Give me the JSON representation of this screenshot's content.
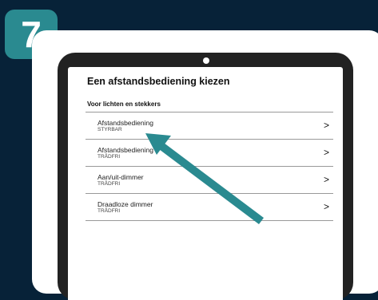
{
  "step": {
    "number": "7"
  },
  "screen": {
    "title": "Een afstandsbediening kiezen",
    "section_label": "Voor lichten en stekkers",
    "items": [
      {
        "name": "Afstandsbediening",
        "sub": "STYRBAR",
        "chevron": ">"
      },
      {
        "name": "Afstandsbediening",
        "sub": "TRÅDFRI",
        "chevron": ">"
      },
      {
        "name": "Aan/uit-dimmer",
        "sub": "TRÅDFRI",
        "chevron": ">"
      },
      {
        "name": "Draadloze dimmer",
        "sub": "TRÅDFRI",
        "chevron": ">"
      }
    ]
  },
  "colors": {
    "background": "#072238",
    "accent": "#2a8a90"
  },
  "icons": {
    "pointer": "arrow-icon"
  }
}
